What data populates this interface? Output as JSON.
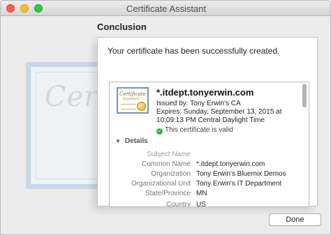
{
  "window": {
    "title": "Certificate Assistant"
  },
  "watermark": {
    "text": "Certif"
  },
  "page": {
    "heading": "Conclusion",
    "message": "Your certificate has been successfully created."
  },
  "certificate": {
    "icon_title": "Certificate",
    "icon_subtitle": "Standard",
    "common_name_title": "*.itdept.tonyerwin.com",
    "issued_by": "Issued by: Tony Erwin's CA",
    "expires": "Expires: Sunday, September 13, 2015 at 10:09:13 PM Central Daylight Time",
    "valid_text": "This certificate is valid",
    "valid_glyph": "✓",
    "details_label": "Details",
    "details_glyph": "▼"
  },
  "details": [
    {
      "label": "Subject Name",
      "value": ""
    },
    {
      "label": "Common Name",
      "value": "*.itdept.tonyerwin.com"
    },
    {
      "label": "Organization",
      "value": "Tony Erwin's Bluemix Demos"
    },
    {
      "label": "Organizational Unit",
      "value": "Tony Erwin's IT Department"
    },
    {
      "label": "State/Province",
      "value": "MN"
    },
    {
      "label": "Country",
      "value": "US"
    }
  ],
  "buttons": {
    "done": "Done"
  },
  "colors": {
    "close": "#fc5b57",
    "minimize": "#fdbc2e",
    "maximize": "#33c748",
    "valid": "#2fb344",
    "cert_border": "#6f94c2"
  }
}
